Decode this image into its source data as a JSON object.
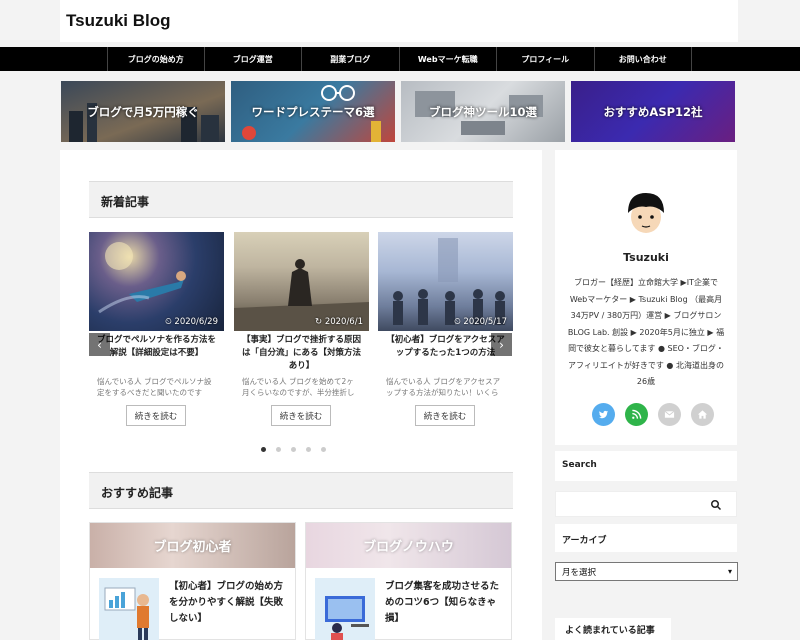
{
  "site": {
    "title": "Tsuzuki Blog"
  },
  "nav": {
    "items": [
      "ブログの始め方",
      "ブログ運営",
      "副業ブログ",
      "Webマーケ転職",
      "プロフィール",
      "お問い合わせ"
    ]
  },
  "banners": [
    {
      "label": "ブログで月5万円稼ぐ"
    },
    {
      "label": "ワードプレステーマ6選"
    },
    {
      "label": "ブログ神ツール10選"
    },
    {
      "label": "おすすめASP12社"
    }
  ],
  "new_posts": {
    "heading": "新着記事",
    "cards": [
      {
        "date": "2020/6/29",
        "title": "ブログでペルソナを作る方法を解説【詳細設定は不要】",
        "excerpt": "悩んでいる人 ブログでペルソナ設定をするべきだと聞いたのですが、どうやって設定すればいいで",
        "read_more": "続きを読む"
      },
      {
        "date": "2020/6/1",
        "title": "【事実】ブログで挫折する原因は「自分流」にある【対策方法あり】",
        "excerpt": "悩んでいる人 ブログを始めて2ヶ月くらいなのですが、半分挫折し",
        "read_more": "続きを読む"
      },
      {
        "date": "2020/5/17",
        "title": "【初心者】ブログをアクセスアップするたった1つの方法",
        "excerpt": "悩んでいる人 ブログをアクセスアップする方法が知りたい！いくら記事を書いても、全然アクセスが",
        "read_more": "続きを読む"
      }
    ],
    "prev": "‹",
    "next": "›",
    "dots": 5,
    "active_dot": 0
  },
  "recommended": {
    "heading": "おすすめ記事",
    "cards": [
      {
        "category": "ブログ初心者",
        "title": "【初心者】ブログの始め方を分かりやすく解説【失敗しない】"
      },
      {
        "category": "ブログノウハウ",
        "title": "ブログ集客を成功させるためのコツ6つ【知らなきゃ損】"
      }
    ]
  },
  "profile": {
    "name": "Tsuzuki",
    "description": "ブロガー【経歴】立命館大学 ▶IT企業でWebマーケター ▶ Tsuzuki Blog （最高月34万PV / 380万円）運営 ▶ ブログサロンBLOG Lab. 創設 ▶ 2020年5月に独立 ▶ 福岡で彼女と暮らしてます ● SEO・ブログ・アフィリエイトが好きです ● 北海道出身の26歳",
    "socials": [
      {
        "icon": "twitter-icon",
        "color": "#55acee"
      },
      {
        "icon": "rss-icon",
        "color": "#2fb44a"
      },
      {
        "icon": "mail-icon",
        "color": "#d0d0d0"
      },
      {
        "icon": "home-icon",
        "color": "#d0d0d0"
      }
    ]
  },
  "sidebar": {
    "search_title": "Search",
    "search_placeholder": "",
    "archive_title": "アーカイブ",
    "archive_select": "月を選択",
    "popular_title": "よく読まれている記事"
  }
}
